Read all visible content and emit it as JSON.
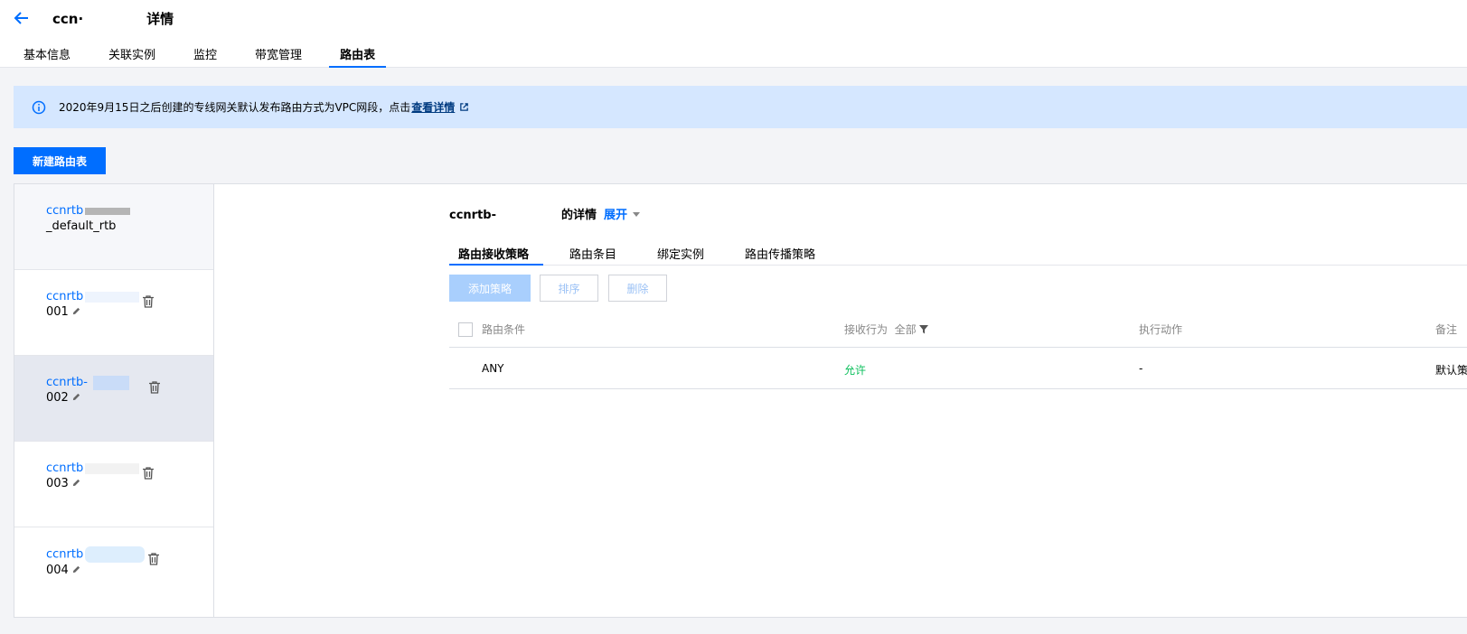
{
  "header": {
    "title_prefix": "ccn·",
    "title_suffix": "详情",
    "tabs": [
      {
        "label": "基本信息",
        "active": false
      },
      {
        "label": "关联实例",
        "active": false
      },
      {
        "label": "监控",
        "active": false
      },
      {
        "label": "带宽管理",
        "active": false
      },
      {
        "label": "路由表",
        "active": true
      }
    ]
  },
  "notice": {
    "text": "2020年9月15日之后创建的专线网关默认发布路由方式为VPC网段，点击",
    "link": "查看详情"
  },
  "toolbar": {
    "new_route_table": "新建路由表"
  },
  "route_tables": [
    {
      "id": "ccnrtb",
      "suffix": "_default_rtb",
      "selected": false
    },
    {
      "id": "ccnrtb",
      "suffix": "001",
      "selected": false
    },
    {
      "id": "ccnrtb-",
      "suffix": "002",
      "selected": true
    },
    {
      "id": "ccnrtb",
      "suffix": "003",
      "selected": false
    },
    {
      "id": "ccnrtb",
      "suffix": "004",
      "selected": false
    }
  ],
  "detail": {
    "title_prefix": "ccnrtb-",
    "title_suffix": "的详情",
    "expand": "展开",
    "tabs": [
      "路由接收策略",
      "路由条目",
      "绑定实例",
      "路由传播策略"
    ],
    "active_tab": "路由接收策略",
    "buttons": {
      "add": "添加策略",
      "sort": "排序",
      "delete": "删除"
    },
    "table": {
      "columns": [
        "路由条件",
        "接收行为",
        "执行动作",
        "备注"
      ],
      "filter_label": "全部",
      "rows": [
        {
          "condition": "ANY",
          "action": "允许",
          "exec": "-",
          "remark": "默认策"
        }
      ]
    }
  },
  "colors": {
    "accent": "#006eff",
    "allow": "#0abf5b",
    "notice_bg": "#d5e7ff"
  }
}
